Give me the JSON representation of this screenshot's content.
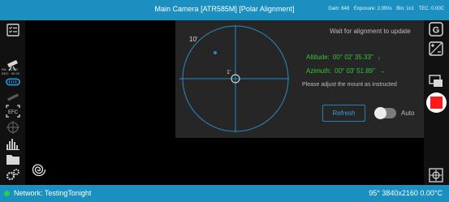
{
  "header": {
    "title": "Main Camera [ATR585M] [Polar Alignment]",
    "gain": "Gain: 648",
    "exposure": "Exposure: 2.000s",
    "bin": "Bin: 1x1",
    "tec": "TEC: 0.00C"
  },
  "left_toolbar": {
    "radec_text": "RA:   10.83\nDEC:  90.93",
    "items": [
      {
        "name": "checklist-icon"
      },
      {
        "name": "telescope-icon"
      },
      {
        "name": "mount-icon"
      },
      {
        "name": "focuser-icon"
      },
      {
        "name": "filter-wheel-icon"
      },
      {
        "name": "efc-icon",
        "label": "EFC"
      },
      {
        "name": "guide-scope-icon"
      },
      {
        "name": "histogram-icon"
      },
      {
        "name": "folder-icon"
      },
      {
        "name": "settings-icon"
      }
    ],
    "accent": "#2a8fd0"
  },
  "right_toolbar": {
    "items": [
      {
        "name": "guide-g-icon",
        "label": "G"
      },
      {
        "name": "exposure-adjust-icon"
      },
      {
        "name": "screen-overlay-icon"
      },
      {
        "name": "stop-capture-button"
      },
      {
        "name": "crosshair-icon"
      }
    ],
    "stop_color": "#ff1a1a"
  },
  "polar_panel": {
    "label_outer": "10'",
    "label_inner": "1'",
    "wait_text": "Wait for alignment to update",
    "altitude_label": "Altitude:",
    "altitude_value": "00° 02' 35.33\"",
    "altitude_arrow": "↓",
    "azimuth_label": "Azimuth:",
    "azimuth_value": "00° 03' 51.89\"",
    "azimuth_arrow": "→",
    "adjust_text": "Please adjust the mount as instructed",
    "refresh_label": "Refresh",
    "auto_label": "Auto",
    "auto_enabled": false,
    "plot_color": "#2a8bc4",
    "value_color": "#35c53a"
  },
  "status_bar": {
    "network": "Network: TestingTonight",
    "network_status_color": "#25d04a",
    "resolution": "95°  3840x2160  0.00°C"
  }
}
